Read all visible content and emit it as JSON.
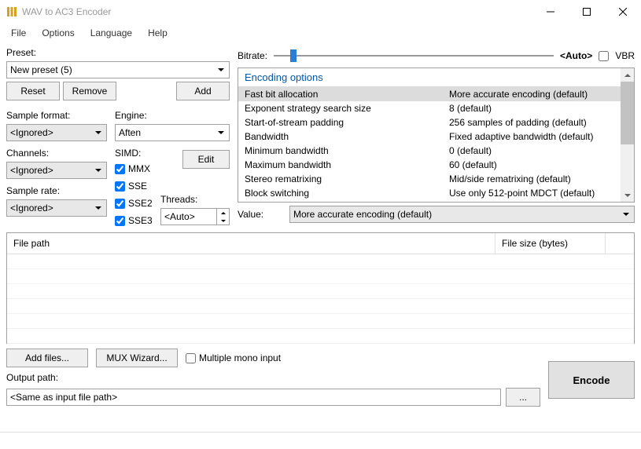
{
  "window": {
    "title": "WAV to AC3 Encoder"
  },
  "menu": {
    "file": "File",
    "options": "Options",
    "language": "Language",
    "help": "Help"
  },
  "preset": {
    "label": "Preset:",
    "value": "New preset (5)",
    "reset": "Reset",
    "remove": "Remove",
    "add": "Add"
  },
  "sample_format": {
    "label": "Sample format:",
    "value": "<Ignored>"
  },
  "engine": {
    "label": "Engine:",
    "value": "Aften",
    "edit": "Edit"
  },
  "channels": {
    "label": "Channels:",
    "value": "<Ignored>"
  },
  "sample_rate": {
    "label": "Sample rate:",
    "value": "<Ignored>"
  },
  "simd": {
    "label": "SIMD:",
    "mmx": "MMX",
    "sse": "SSE",
    "sse2": "SSE2",
    "sse3": "SSE3"
  },
  "threads": {
    "label": "Threads:",
    "value": "<Auto>"
  },
  "bitrate": {
    "label": "Bitrate:",
    "value": "<Auto>",
    "vbr": "VBR"
  },
  "options": {
    "header": "Encoding options",
    "items": [
      {
        "name": "Fast bit allocation",
        "value": "More accurate encoding (default)"
      },
      {
        "name": "Exponent strategy search size",
        "value": "8 (default)"
      },
      {
        "name": "Start-of-stream padding",
        "value": "256 samples of padding (default)"
      },
      {
        "name": "Bandwidth",
        "value": "Fixed adaptive bandwidth (default)"
      },
      {
        "name": "Minimum bandwidth",
        "value": "0 (default)"
      },
      {
        "name": "Maximum bandwidth",
        "value": "60 (default)"
      },
      {
        "name": "Stereo rematrixing",
        "value": "Mid/side rematrixing (default)"
      },
      {
        "name": "Block switching",
        "value": "Use only 512-point MDCT (default)"
      }
    ]
  },
  "value_row": {
    "label": "Value:",
    "value": "More accurate encoding (default)"
  },
  "file_table": {
    "path": "File path",
    "size": "File size (bytes)"
  },
  "add_files": "Add files...",
  "mux": "MUX Wizard...",
  "multi_mono": "Multiple mono input",
  "output": {
    "label": "Output path:",
    "value": "<Same as input file path>",
    "browse": "..."
  },
  "encode": "Encode"
}
